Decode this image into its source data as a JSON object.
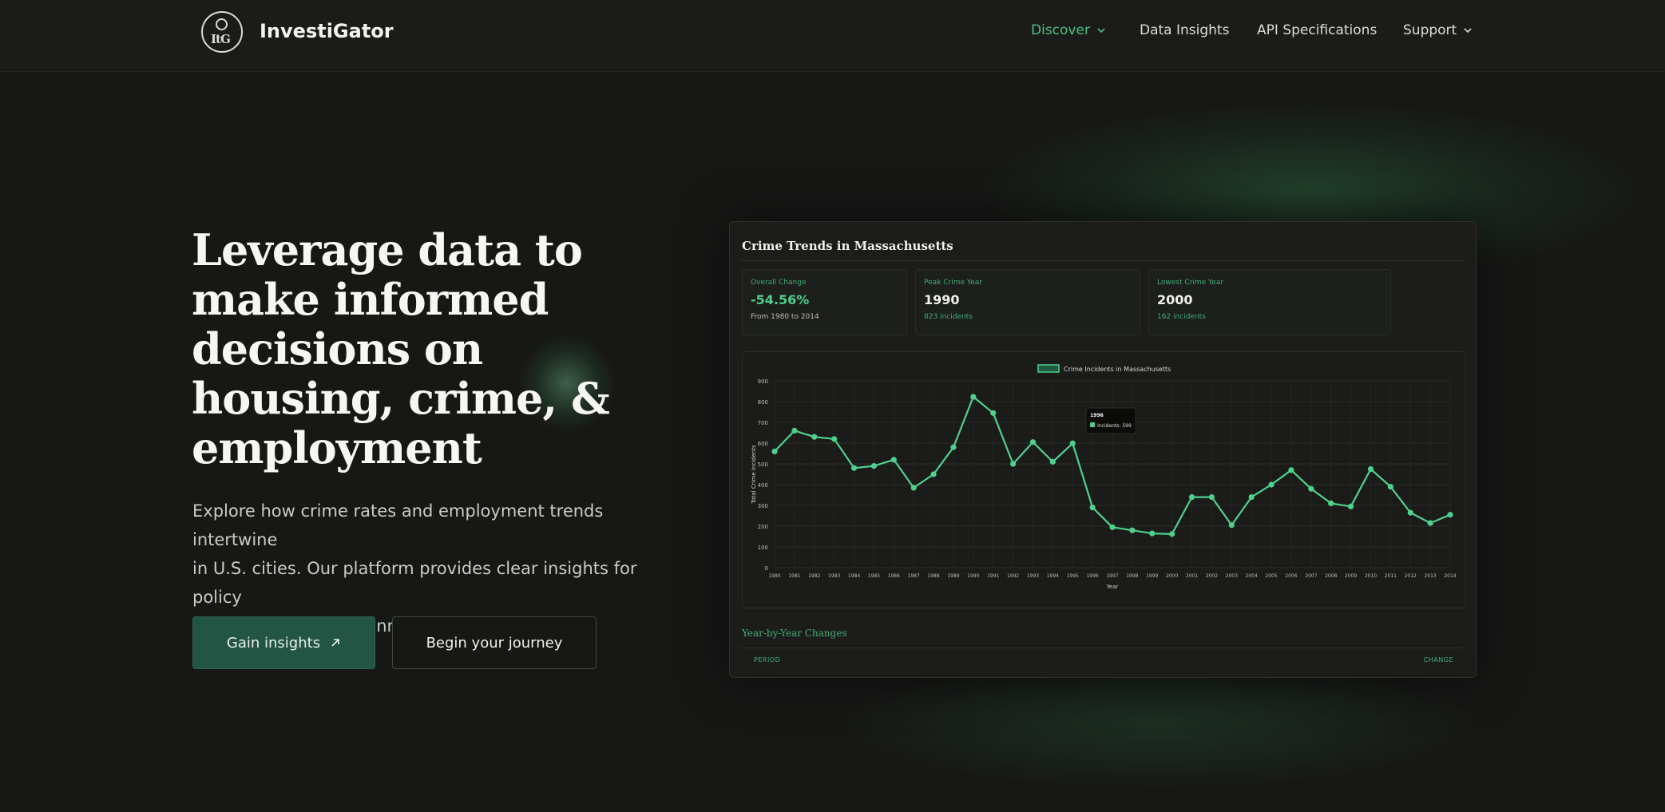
{
  "brand": {
    "name": "InvestiGator",
    "logo_text": "ItG"
  },
  "nav": [
    {
      "label": "Discover",
      "dropdown": true,
      "active": true
    },
    {
      "label": "Data Insights",
      "dropdown": false,
      "active": false
    },
    {
      "label": "API Specifications",
      "dropdown": false,
      "active": false
    },
    {
      "label": "Support",
      "dropdown": true,
      "active": false
    }
  ],
  "hero": {
    "title_lines": [
      "Leverage data to",
      "make informed",
      "decisions on",
      "housing, crime, &",
      "employment"
    ],
    "description_lines": [
      "Explore how crime rates and employment trends intertwine",
      "in U.S. cities. Our platform provides clear insights for policy",
      "makers and urban planners."
    ],
    "primary_button": "Gain insights",
    "primary_icon": "arrow-up-right-icon",
    "secondary_button": "Begin your journey"
  },
  "dashboard": {
    "title": "Crime Trends in Massachusetts",
    "stats": [
      {
        "label": "Overall Change",
        "value": "-54.56%",
        "sub": "From 1980 to 2014"
      },
      {
        "label": "Peak Crime Year",
        "value": "1990",
        "sub": "823 incidents"
      },
      {
        "label": "Lowest Crime Year",
        "value": "2000",
        "sub": "162 incidents"
      }
    ],
    "yoy_title": "Year-by-Year Changes",
    "yoy_columns": [
      "PERIOD",
      "CHANGE"
    ]
  },
  "colors": {
    "accent": "#4fd08d",
    "accent_dark": "#225544",
    "background": "#171816"
  },
  "chart_data": {
    "type": "line",
    "title": "",
    "legend": "top-center",
    "xlabel": "Year",
    "ylabel": "Total Crime Incidents",
    "ylim": [
      0,
      900
    ],
    "yticks": [
      0,
      100,
      200,
      300,
      400,
      500,
      600,
      700,
      800,
      900
    ],
    "grid": true,
    "x": [
      "1980",
      "1981",
      "1982",
      "1983",
      "1984",
      "1985",
      "1986",
      "1987",
      "1988",
      "1989",
      "1990",
      "1991",
      "1992",
      "1993",
      "1994",
      "1995",
      "1996",
      "1997",
      "1998",
      "1999",
      "2000",
      "2001",
      "2002",
      "2003",
      "2004",
      "2005",
      "2006",
      "2007",
      "2008",
      "2009",
      "2010",
      "2011",
      "2012",
      "2013",
      "2014"
    ],
    "series": [
      {
        "name": "Crime Incidents in Massachusetts",
        "values": [
          560,
          660,
          630,
          620,
          480,
          490,
          520,
          385,
          450,
          580,
          823,
          745,
          500,
          605,
          510,
          599,
          290,
          195,
          180,
          165,
          162,
          340,
          340,
          205,
          340,
          400,
          470,
          380,
          310,
          295,
          475,
          390,
          265,
          215,
          255
        ]
      }
    ],
    "tooltip": {
      "title": "1996",
      "label": "Incidents",
      "value": "599"
    }
  }
}
